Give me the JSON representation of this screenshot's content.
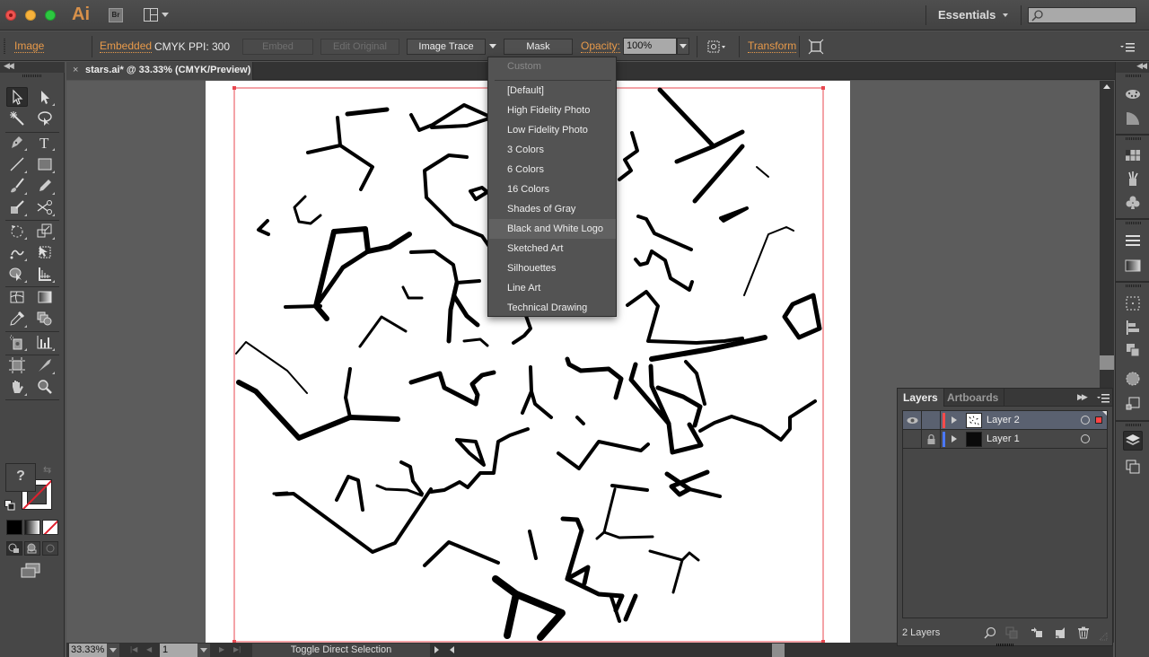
{
  "window": {
    "app_logo": "Ai",
    "bridge_label": "Br",
    "workspace": "Essentials",
    "search_placeholder": ""
  },
  "control_bar": {
    "object_type": "Image",
    "embedded_link": "Embedded",
    "color_mode": "CMYK",
    "ppi": "PPI: 300",
    "embed_button": "Embed",
    "edit_original_button": "Edit Original",
    "image_trace_button": "Image Trace",
    "mask_button": "Mask",
    "opacity_label": "Opacity:",
    "opacity_value": "100%",
    "transform_link": "Transform"
  },
  "document_tab": {
    "close": "×",
    "title": "stars.ai* @ 33.33% (CMYK/Preview)"
  },
  "image_trace_menu": {
    "header": "Custom",
    "items": [
      {
        "label": "[Default]"
      },
      {
        "label": "High Fidelity Photo"
      },
      {
        "label": "Low Fidelity Photo"
      },
      {
        "label": "3 Colors"
      },
      {
        "label": "6 Colors"
      },
      {
        "label": "16 Colors"
      },
      {
        "label": "Shades of Gray"
      },
      {
        "label": "Black and White Logo",
        "hovered": true
      },
      {
        "label": "Sketched Art"
      },
      {
        "label": "Silhouettes"
      },
      {
        "label": "Line Art"
      },
      {
        "label": "Technical Drawing"
      }
    ]
  },
  "tools": {
    "fill_state": "?",
    "items": [
      "selection",
      "direct-selection",
      "magic-wand",
      "lasso",
      "pen",
      "type",
      "line-segment",
      "rectangle",
      "paintbrush",
      "pencil",
      "blob-brush",
      "scissors",
      "rotate",
      "scale",
      "warp",
      "free-transform",
      "shape-builder",
      "graph",
      "mesh",
      "gradient",
      "eyedropper",
      "blend",
      "symbol-sprayer",
      "column-graph",
      "artboard",
      "slice",
      "hand",
      "zoom"
    ]
  },
  "status_bar": {
    "zoom": "33.33%",
    "artboard_number": "1",
    "status_text": "Toggle Direct Selection"
  },
  "layers_panel": {
    "tabs": [
      "Layers",
      "Artboards"
    ],
    "layers": [
      {
        "name": "Layer 2",
        "color": "#ff4b4b",
        "visible": true,
        "locked": false,
        "selected": true
      },
      {
        "name": "Layer 1",
        "color": "#4b78ff",
        "visible": false,
        "locked": true,
        "selected": false
      }
    ],
    "count": "2 Layers"
  },
  "colors": {
    "accent_link": "#e89a4a",
    "artboard_border": "#e8474f",
    "stroke_none": "#e0202e"
  }
}
